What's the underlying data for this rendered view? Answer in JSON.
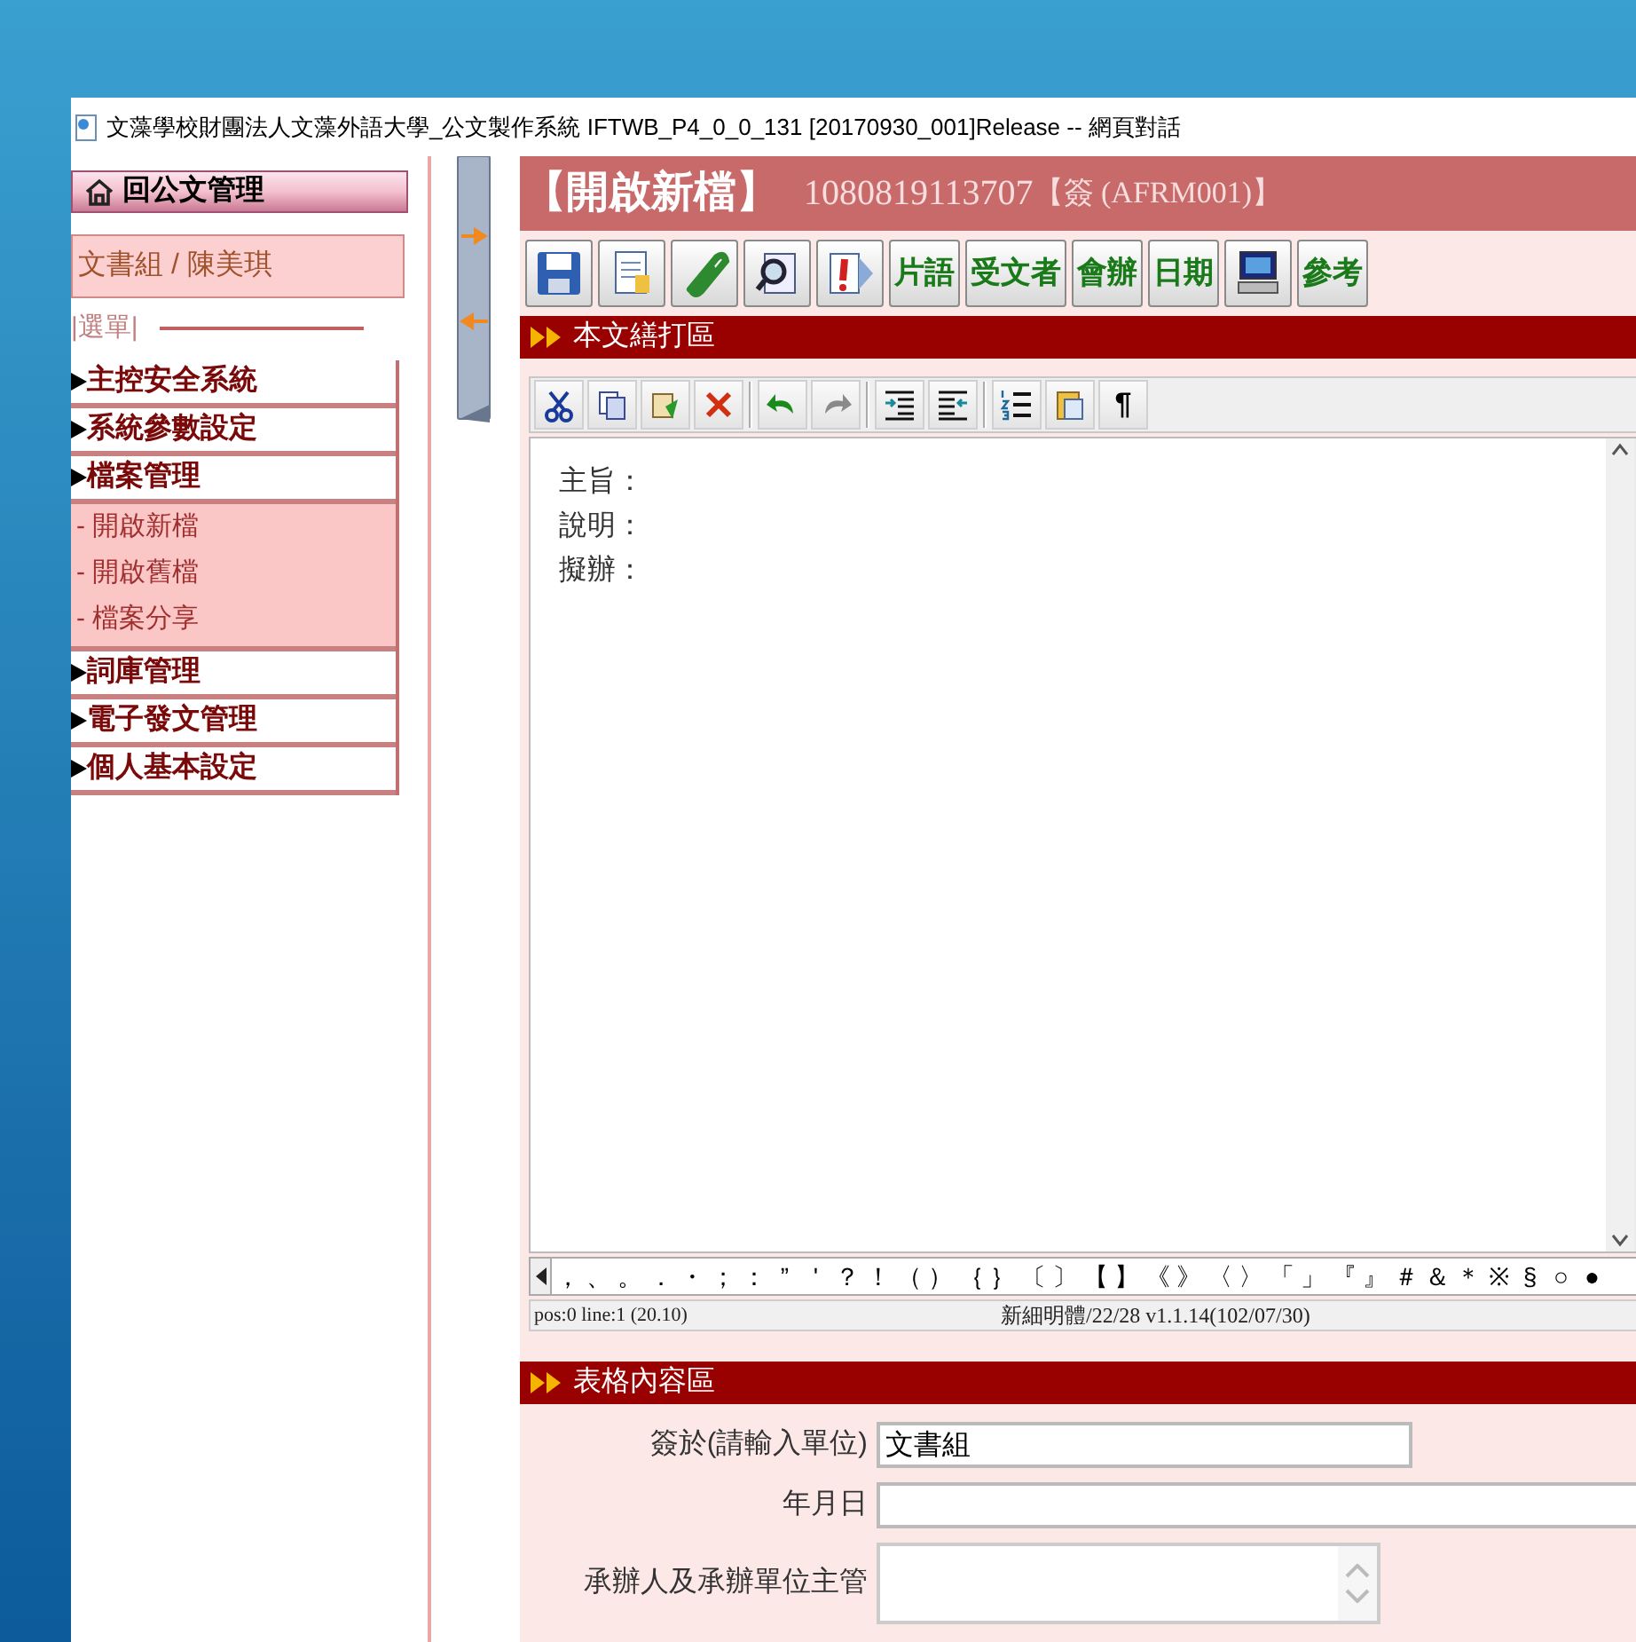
{
  "window": {
    "title": "文藻學校財團法人文藻外語大學_公文製作系統 IFTWB_P4_0_0_131 [20170930_001]Release -- 網頁對話"
  },
  "sidebar": {
    "home_button": "回公文管理",
    "user": "文書組 / 陳美琪",
    "menu_label": "|選單|",
    "items": [
      {
        "label": "主控安全系統"
      },
      {
        "label": "系統參數設定"
      },
      {
        "label": "檔案管理",
        "children": [
          {
            "label": "- 開啟新檔"
          },
          {
            "label": "- 開啟舊檔"
          },
          {
            "label": "- 檔案分享"
          }
        ]
      },
      {
        "label": "詞庫管理"
      },
      {
        "label": "電子發文管理"
      },
      {
        "label": "個人基本設定"
      }
    ]
  },
  "header": {
    "title": "【開啟新檔】",
    "doc_number": "1080819113707",
    "form_code": "【簽 (AFRM001)】"
  },
  "toolbar": [
    {
      "kind": "save"
    },
    {
      "kind": "document"
    },
    {
      "kind": "clip"
    },
    {
      "kind": "search"
    },
    {
      "kind": "alert"
    },
    {
      "kind": "label",
      "label": "片語"
    },
    {
      "kind": "label",
      "label": "受文者"
    },
    {
      "kind": "label",
      "label": "會辦"
    },
    {
      "kind": "label",
      "label": "日期"
    },
    {
      "kind": "monitor"
    },
    {
      "kind": "label",
      "label": "參考"
    }
  ],
  "editor_section": {
    "title": "本文繕打區"
  },
  "editor_toolbar": [
    {
      "kind": "cut"
    },
    {
      "kind": "copy"
    },
    {
      "kind": "paste"
    },
    {
      "kind": "delete"
    },
    {
      "kind": "sep"
    },
    {
      "kind": "undo"
    },
    {
      "kind": "redo"
    },
    {
      "kind": "sep"
    },
    {
      "kind": "indent"
    },
    {
      "kind": "outdent"
    },
    {
      "kind": "sep"
    },
    {
      "kind": "list"
    },
    {
      "kind": "clipboard"
    },
    {
      "kind": "text",
      "label": "¶"
    }
  ],
  "editor_lines": [
    "主旨：",
    "說明：",
    "擬辦："
  ],
  "symbols": [
    "，",
    "、",
    "。",
    "．",
    "・",
    "；",
    "：",
    "”",
    "'",
    "？",
    "！",
    "（",
    "）",
    "｛",
    "｝",
    "〔",
    "〕",
    "【",
    "】",
    "《",
    "》",
    "〈",
    "〉",
    "「",
    "」",
    "『",
    "』",
    "＃",
    "＆",
    "＊",
    "※",
    "§",
    "○",
    "●"
  ],
  "status_bar": {
    "position": "pos:0  line:1 (20.10)",
    "info": "新細明體/22/28 v1.1.14(102/07/30)"
  },
  "form_section": {
    "title": "表格內容區",
    "fields": [
      {
        "kind": "short",
        "label": "簽於(請輸入單位)",
        "value": "文書組"
      },
      {
        "kind": "wide",
        "label": "年月日"
      },
      {
        "kind": "textarea",
        "label": "承辦人及承辦單位主管"
      }
    ]
  }
}
